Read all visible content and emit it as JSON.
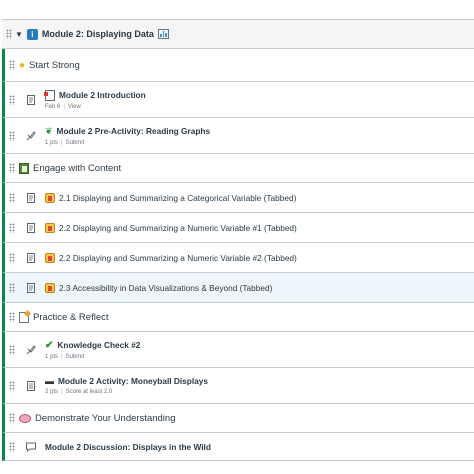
{
  "module": {
    "title": "Module 2: Displaying Data",
    "icon": "module-info-icon",
    "trailing_icon": "bar-chart-icon"
  },
  "rows": [
    {
      "kind": "subheader",
      "icon": "lightbulb-icon",
      "title": "Start Strong"
    },
    {
      "kind": "item",
      "type_icon": "page-icon",
      "lead_icon": "document-icon",
      "title": "Module 2 Introduction",
      "bold": true,
      "meta": [
        "Feb 6",
        "View"
      ]
    },
    {
      "kind": "item",
      "type_icon": "quiz-icon",
      "lead_icon": "seedling-icon",
      "title": "Module 2 Pre-Activity: Reading Graphs",
      "bold": true,
      "meta": [
        "1 pts",
        "Submit"
      ]
    },
    {
      "kind": "subheader",
      "icon": "notebook-icon",
      "title": "Engage with Content"
    },
    {
      "kind": "item",
      "type_icon": "page-icon",
      "lead_icon": "book-icon",
      "title": "2.1 Displaying and Summarizing a Categorical Variable (Tabbed)",
      "bold": false,
      "meta": []
    },
    {
      "kind": "item",
      "type_icon": "page-icon",
      "lead_icon": "book-icon",
      "title": "2.2 Displaying and Summarizing a Numeric Variable #1 (Tabbed)",
      "bold": false,
      "meta": []
    },
    {
      "kind": "item",
      "type_icon": "page-icon",
      "lead_icon": "book-icon",
      "title": "2.2 Displaying and Summarizing a Numeric Variable #2 (Tabbed)",
      "bold": false,
      "meta": []
    },
    {
      "kind": "item",
      "type_icon": "page-icon",
      "lead_icon": "book-icon",
      "title": "2.3 Accessibility in Data Visualizations & Beyond (Tabbed)",
      "bold": false,
      "meta": [],
      "highlight": true
    },
    {
      "kind": "subheader",
      "icon": "memo-icon",
      "title": "Practice & Reflect"
    },
    {
      "kind": "item",
      "type_icon": "quiz-icon",
      "lead_icon": "checkmark-icon",
      "title": "Knowledge Check #2",
      "bold": true,
      "meta": [
        "1 pts",
        "Submit"
      ]
    },
    {
      "kind": "item",
      "type_icon": "assignment-icon",
      "lead_icon": "laptop-icon",
      "title": "Module 2 Activity: Moneyball Displays",
      "bold": true,
      "meta": [
        "2 pts",
        "Score at least 2.0"
      ]
    },
    {
      "kind": "subheader",
      "icon": "speech-bubble-icon",
      "title": "Demonstrate Your Understanding"
    },
    {
      "kind": "item",
      "type_icon": "discussion-icon",
      "lead_icon": "",
      "title": "Module 2 Discussion: Displays in the Wild",
      "bold": true,
      "meta": []
    }
  ]
}
